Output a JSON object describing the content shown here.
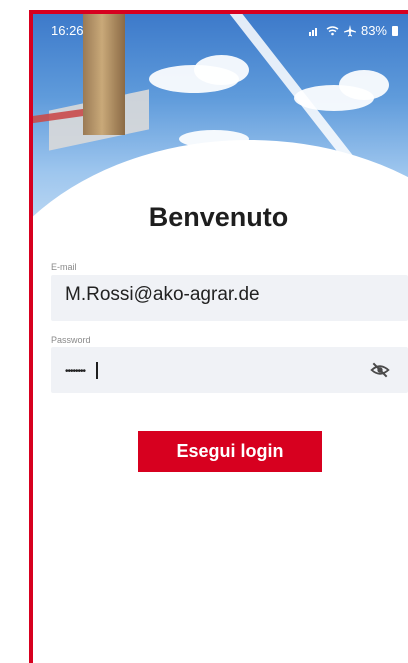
{
  "status_bar": {
    "time": "16:26",
    "signal_text": "◂",
    "battery": "83%"
  },
  "login": {
    "title": "Benvenuto",
    "email_label": "E-mail",
    "email_value": "M.Rossi@ako-agrar.de",
    "password_label": "Password",
    "password_value": "••••••••",
    "submit_label": "Esegui login"
  },
  "theme": {
    "accent": "#d7001f",
    "field_bg": "#f0f2f6"
  },
  "icons": {
    "password_toggle": "eye-off-icon"
  }
}
